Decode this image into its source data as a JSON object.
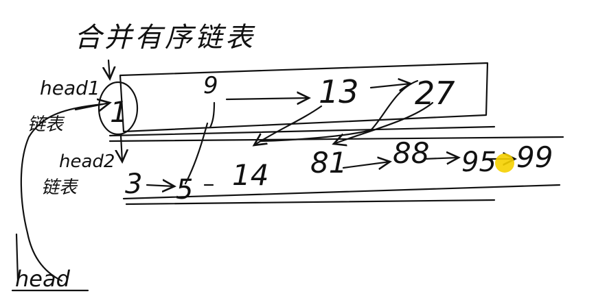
{
  "title": "合并有序链表",
  "labels": {
    "head1": "head1",
    "head2": "head2",
    "list1_label": "链表",
    "list2_label": "链表",
    "head": "head"
  },
  "list1": [
    "1",
    "9",
    "13",
    "27"
  ],
  "list2": [
    "3",
    "5",
    "14",
    "81",
    "88",
    "95",
    "99"
  ],
  "colors": {
    "ink": "#111111",
    "background": "#ffffff",
    "pointer_highlight": "#f5d000"
  }
}
